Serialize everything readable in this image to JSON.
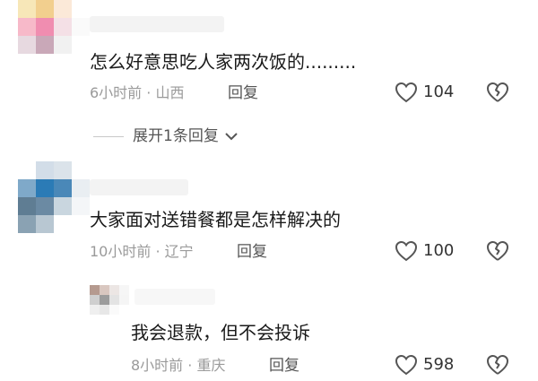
{
  "comments": [
    {
      "text": "怎么好意思吃人家两次饭的.........",
      "meta": "6小时前 · 山西",
      "reply_label": "回复",
      "likes": "104",
      "expand_label": "展开1条回复",
      "avatar_colors": [
        "#f7e7b8",
        "#f2cf8e",
        "#fbe9d8",
        "#ffffff",
        "#f7b9c9",
        "#f08db0",
        "#f4e0e6",
        "#fafafa",
        "#e7d9e0",
        "#c9a8b8",
        "#f1f1f1",
        "#ffffff",
        "#ffffff",
        "#ffffff",
        "#ffffff",
        "#ffffff"
      ]
    },
    {
      "text": "大家面对送错餐都是怎样解决的",
      "meta": "10小时前 · 辽宁",
      "reply_label": "回复",
      "likes": "100",
      "avatar_colors": [
        "#ffffff",
        "#d2dde8",
        "#dbe3ea",
        "#ffffff",
        "#7fa9c9",
        "#2b7bb6",
        "#4a88b8",
        "#e9eef2",
        "#5f7d93",
        "#6b8aa3",
        "#c9d6df",
        "#f4f6f8",
        "#8aa2b3",
        "#b8c7d2",
        "#ffffff",
        "#ffffff"
      ]
    },
    {
      "text": "我会退款，但不会投诉",
      "meta": "8小时前 · 重庆",
      "reply_label": "回复",
      "likes": "598",
      "avatar_colors": [
        "#b59a8f",
        "#d9c7c0",
        "#ece6e4",
        "#f6f6f6",
        "#cfcfcf",
        "#9c9c9c",
        "#e3e3e3",
        "#f5f5f5",
        "#efefef",
        "#e7e7e7",
        "#fafafa",
        "#ffffff"
      ]
    }
  ],
  "icons": {
    "like": "heart-outline-icon",
    "dislike": "broken-heart-icon",
    "expand": "chevron-down-icon"
  },
  "colors": {
    "text": "#1a1a1a",
    "meta": "#9a9a9a",
    "icon": "#555555"
  }
}
